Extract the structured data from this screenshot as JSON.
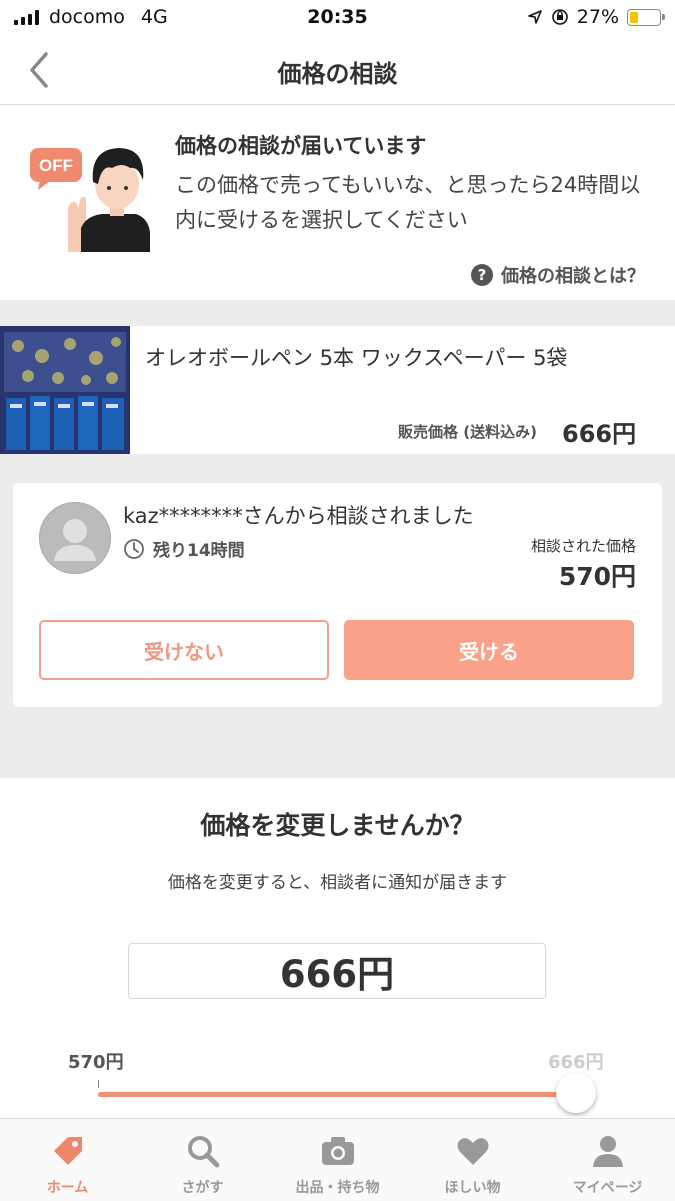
{
  "status": {
    "carrier": "docomo",
    "network": "4G",
    "time": "20:35",
    "battery": "27%"
  },
  "header": {
    "title": "価格の相談"
  },
  "notice": {
    "badge": "OFF",
    "title": "価格の相談が届いています",
    "body": "この価格で売ってもいいな、と思ったら24時間以内に受けるを選択してください",
    "help_link": "価格の相談とは？"
  },
  "product": {
    "title": "オレオボールペン 5本 ワックスペーパー 5袋",
    "price_label": "販売価格 (送料込み)",
    "price": "666円"
  },
  "offer": {
    "from": "kaz********さんから相談されました",
    "remaining": "残り14時間",
    "offered_label": "相談された価格",
    "offered_price": "570円",
    "decline_label": "受けない",
    "accept_label": "受ける"
  },
  "change_price": {
    "title": "価格を変更しませんか？",
    "description": "価格を変更すると、相談者に通知が届きます",
    "current_value": "666円",
    "slider_min_label": "570円",
    "slider_max_label": "666円",
    "slider_min": 570,
    "slider_max": 666,
    "slider_value": 666
  },
  "tabbar": {
    "items": [
      {
        "label": "ホーム",
        "icon": "price-tag-icon",
        "active": true
      },
      {
        "label": "さがす",
        "icon": "search-icon",
        "active": false
      },
      {
        "label": "出品・持ち物",
        "icon": "camera-icon",
        "active": false
      },
      {
        "label": "ほしい物",
        "icon": "heart-icon",
        "active": false
      },
      {
        "label": "マイページ",
        "icon": "person-icon",
        "active": false
      }
    ]
  },
  "colors": {
    "accent": "#f9a189",
    "accent_text": "#f0876d",
    "gray_band": "#ececec"
  }
}
